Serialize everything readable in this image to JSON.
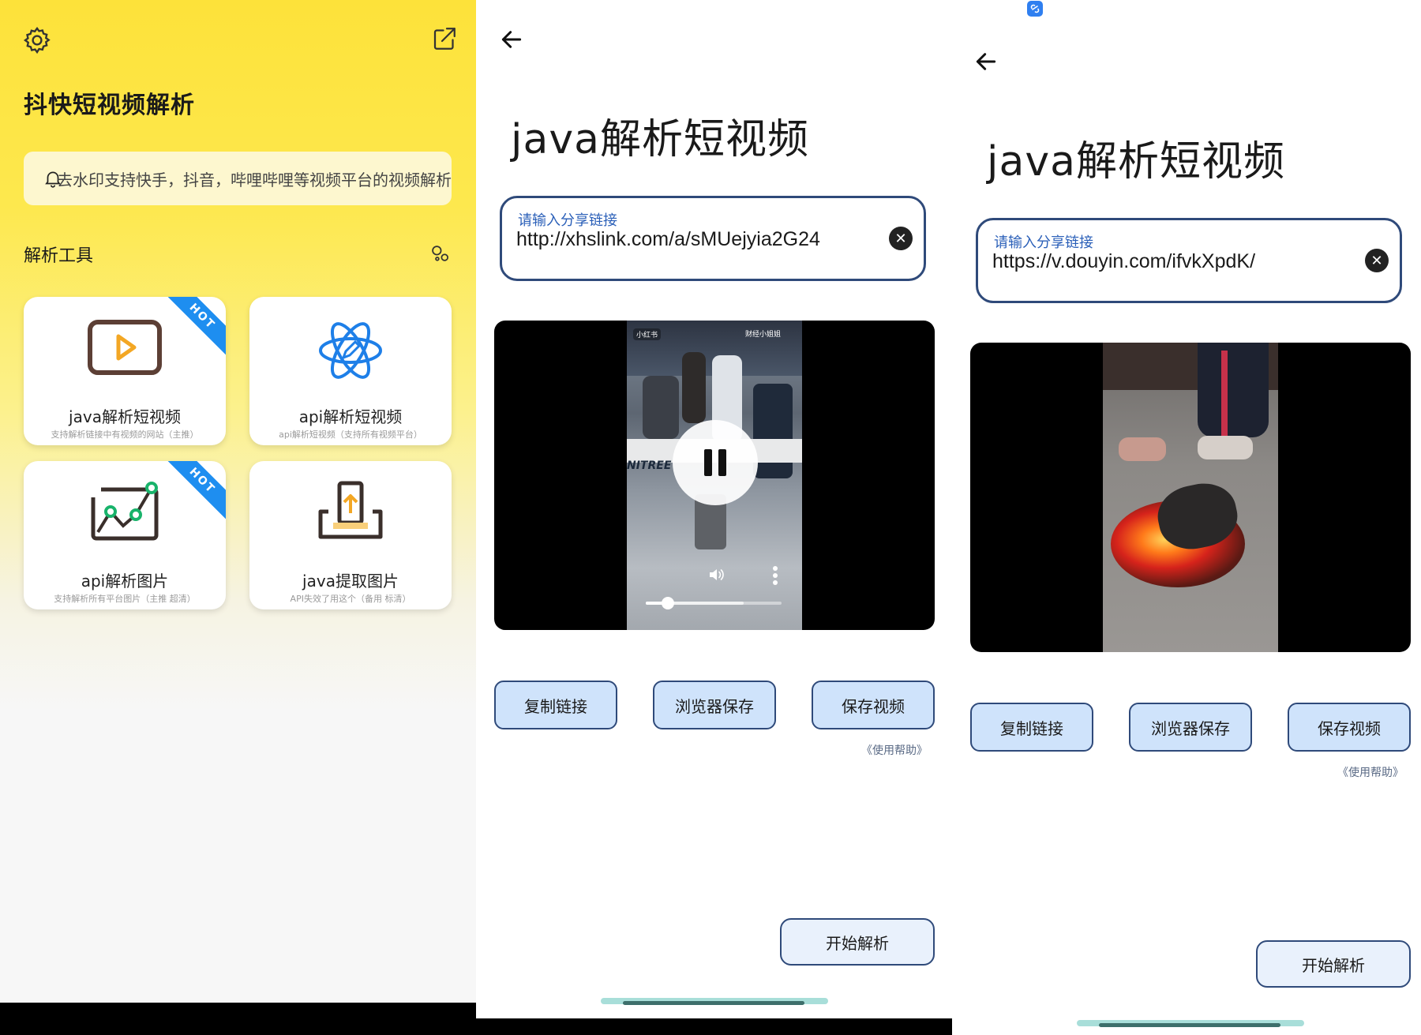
{
  "home": {
    "title": "抖快短视频解析",
    "notice": "去水印支持快手，抖音，哔哩哔哩等视频平台的视频解析",
    "section_title": "解析工具",
    "cards": [
      {
        "title": "java解析短视频",
        "subtitle": "支持解析链接中有视频的网站（主推）",
        "hot": true
      },
      {
        "title": "api解析短视频",
        "subtitle": "api解析短视频（支持所有视频平台）",
        "hot": false
      },
      {
        "title": "api解析图片",
        "subtitle": "支持解析所有平台图片（主推 超清）",
        "hot": true
      },
      {
        "title": "java提取图片",
        "subtitle": "API失效了用这个（备用 标清）",
        "hot": false
      }
    ],
    "hot_label": "HOT"
  },
  "detail_a": {
    "title": "java解析短视频",
    "input_label": "请输入分享链接",
    "input_value": "http://xhslink.com/a/sMUejyia2G24",
    "video": {
      "overlay_tag": "小红书",
      "overlay_author": "财经小姐姐",
      "scene_text": "NITREE",
      "progress": 0.16,
      "buffered": 0.72
    },
    "buttons": [
      "复制链接",
      "浏览器保存",
      "保存视频"
    ],
    "help": "《使用帮助》",
    "start": "开始解析"
  },
  "detail_b": {
    "title": "java解析短视频",
    "input_label": "请输入分享链接",
    "input_value": "https://v.douyin.com/ifvkXpdK/",
    "buttons": [
      "复制链接",
      "浏览器保存",
      "保存视频"
    ],
    "help": "《使用帮助》",
    "start": "开始解析"
  },
  "colors": {
    "accent_yellow": "#fde23a",
    "button_fill": "#cfe3fb",
    "button_border": "#2f4a7a",
    "label_blue": "#2a5fb8",
    "hot_blue": "#1e8ef0"
  }
}
